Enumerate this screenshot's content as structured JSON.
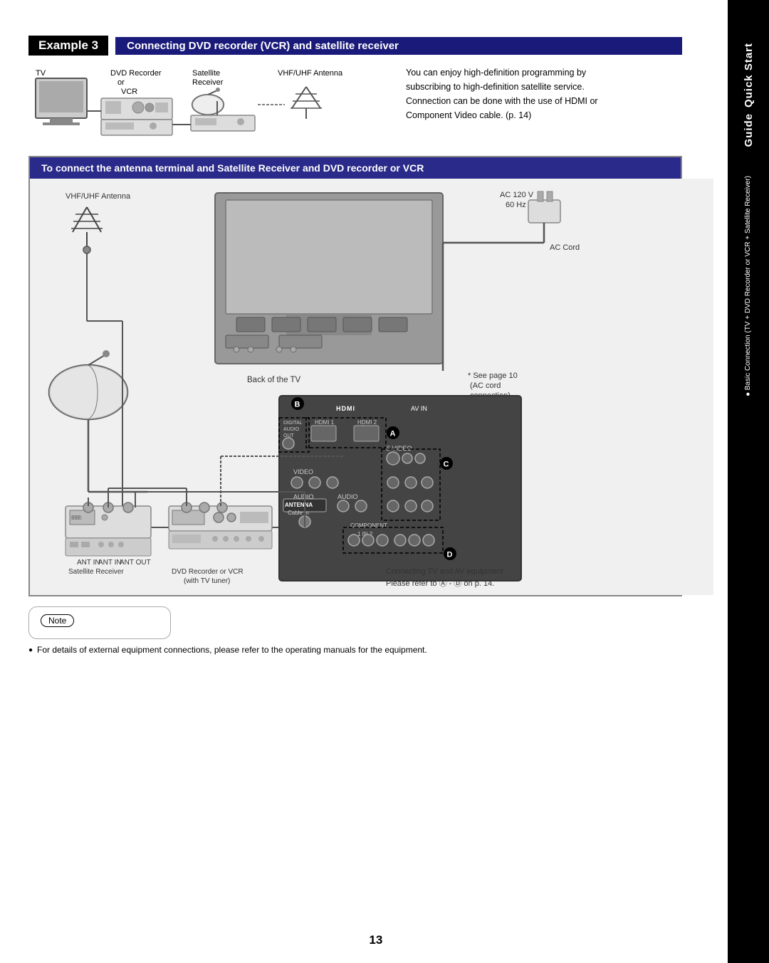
{
  "page": {
    "number": "13",
    "background": "#ffffff"
  },
  "sidebar": {
    "background": "#000000",
    "quick_start": "Quick Start",
    "guide": "Guide",
    "bullet": "●",
    "description": "Basic Connection (TV + DVD Recorder or VCR + Satellite Receiver)"
  },
  "example3": {
    "label": "Example 3",
    "title": "Connecting DVD recorder (VCR) and satellite receiver",
    "description": "You can enjoy high-definition programming by subscribing to high-definition satellite service. Connection can be done with the use of HDMI or Component Video cable. (p. 14)"
  },
  "main_diagram": {
    "title": "To connect the antenna terminal and Satellite Receiver and DVD recorder or VCR",
    "labels": {
      "vhf_uhf": "VHF/UHF Antenna",
      "back_of_tv": "Back of the TV",
      "see_page": "* See page 10",
      "ac_cord_conn": "(AC cord connection)",
      "ac_voltage": "AC 120 V",
      "ac_hz": "60 Hz",
      "ac_cord": "AC Cord",
      "hdmi": "HDMI",
      "av_in": "AV IN",
      "hdmi1": "HDMI 1",
      "hdmi2": "HDMI 2",
      "digital_audio_out": "DIGITAL AUDIO OUT",
      "s_video": "S VIDEO",
      "video": "VIDEO",
      "antenna": "ANTENNA",
      "cable_in": "Cable In",
      "audio": "AUDIO",
      "component": "COMPONENT",
      "in": "IN",
      "ant_in_1": "ANT IN",
      "ant_in_2": "ANT IN",
      "ant_out": "ANT OUT",
      "satellite_receiver": "Satellite Receiver",
      "dvd_recorder": "DVD Recorder or VCR",
      "with_tv_tuner": "(with TV tuner)",
      "connecting_tv": "Connecting TV and AV equipment",
      "please_refer": "Please refer to Ⓐ - Ⓓ on p. 14.",
      "marker_a": "A",
      "marker_b": "B",
      "marker_c": "C",
      "marker_d": "D"
    }
  },
  "top_diagram": {
    "tv_label": "TV",
    "dvd_recorder": "DVD Recorder",
    "or": "or",
    "vcr": "VCR",
    "satellite": "Satellite",
    "receiver": "Receiver",
    "vhf_uhf": "VHF/UHF Antenna"
  },
  "note": {
    "label": "Note",
    "text": "For details of external equipment connections, please refer to the operating manuals for the equipment."
  }
}
